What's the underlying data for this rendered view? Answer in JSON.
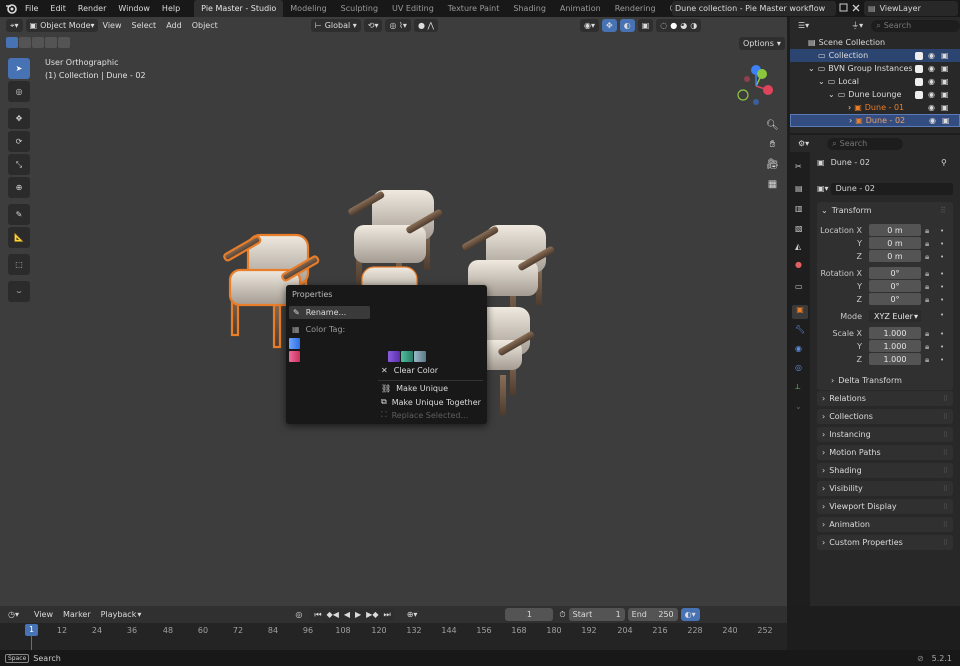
{
  "topbar": {
    "menus": [
      "File",
      "Edit",
      "Render",
      "Window",
      "Help"
    ],
    "workspaces": [
      "Pie Master - Studio",
      "Modeling",
      "Sculpting",
      "UV Editing",
      "Texture Paint",
      "Shading",
      "Animation",
      "Rendering",
      "Composi"
    ],
    "scene_name": "Dune collection - Pie Master workflow",
    "view_layer": "ViewLayer"
  },
  "viewport_header": {
    "mode": "Object Mode",
    "menus": [
      "View",
      "Select",
      "Add",
      "Object"
    ],
    "transform_orientation": "Global",
    "options_label": "Options"
  },
  "viewport": {
    "view_name": "User Orthographic",
    "collection_info": "(1) Collection | Dune - 02"
  },
  "context_menu": {
    "title": "Properties",
    "rename": "Rename...",
    "color_tag": "Color Tag:",
    "clear_color": "Clear Color",
    "make_unique": "Make Unique",
    "make_unique_together": "Make Unique Together",
    "replace_selected": "Replace Selected..."
  },
  "outliner": {
    "search_placeholder": "Search",
    "rows": [
      {
        "label": "Scene Collection"
      },
      {
        "label": "Collection"
      },
      {
        "label": "BVN Group Instances"
      },
      {
        "label": "Local"
      },
      {
        "label": "Dune Lounge"
      },
      {
        "label": "Dune - 01"
      },
      {
        "label": "Dune - 02"
      }
    ]
  },
  "properties": {
    "search_placeholder": "Search",
    "object_name": "Dune - 02",
    "data_name": "Dune - 02",
    "transform_title": "Transform",
    "location_label": "Location X",
    "location": [
      "0 m",
      "0 m",
      "0 m"
    ],
    "rotation_label": "Rotation X",
    "rotation": [
      "0°",
      "0°",
      "0°"
    ],
    "mode_label": "Mode",
    "mode_value": "XYZ Euler",
    "scale_label": "Scale X",
    "scale": [
      "1.000",
      "1.000",
      "1.000"
    ],
    "axis_y": "Y",
    "axis_z": "Z",
    "delta_transform": "Delta Transform",
    "panels": [
      "Relations",
      "Collections",
      "Instancing",
      "Motion Paths",
      "Shading",
      "Visibility",
      "Viewport Display",
      "Animation",
      "Custom Properties"
    ]
  },
  "timeline": {
    "menus": [
      "View",
      "Marker",
      "Playback"
    ],
    "current_frame": "1",
    "start_label": "Start",
    "start_value": "1",
    "end_label": "End",
    "end_value": "250",
    "ticks": [
      "12",
      "24",
      "36",
      "48",
      "60",
      "72",
      "84",
      "96",
      "108",
      "120",
      "132",
      "144",
      "156",
      "168",
      "180",
      "192",
      "204",
      "216",
      "228",
      "240",
      "252"
    ],
    "playhead": "1"
  },
  "statusbar": {
    "key": "Space",
    "action": "Search",
    "version": "5.2.1"
  },
  "colors": {
    "accent": "#4772b3",
    "selected_outline": "#e87d2a",
    "viewport_bg": "#3d3d3d"
  }
}
